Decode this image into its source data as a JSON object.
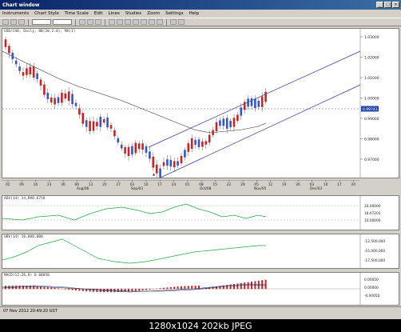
{
  "window": {
    "title": "Chart window"
  },
  "menu": [
    "Instruments",
    "Chart Style",
    "Time Scale",
    "Edit",
    "Lines",
    "Studies",
    "Zoom",
    "Settings",
    "Help"
  ],
  "chart": {
    "header": "USD/CAD, Daily, BB(20,2.0), MA(1)",
    "price_labels": [
      "1.03000",
      "1.02000",
      "1.01000",
      "1.00000",
      "0.99000",
      "0.98000",
      "0.97000"
    ],
    "current_price": "0.99741",
    "date_labels": [
      "02",
      "09",
      "16",
      "23",
      "30",
      "06",
      "13",
      "20",
      "27",
      "03",
      "10",
      "17",
      "24",
      "01",
      "08",
      "15",
      "22",
      "29",
      "05",
      "12",
      "19",
      "26",
      "03",
      "10",
      "17",
      "24"
    ],
    "month_labels": [
      "Aug/06",
      "Sep/03",
      "Oct/08",
      "Nov/05",
      "Dec/03"
    ],
    "low_label": "0.97000"
  },
  "indicator1": {
    "header": "ADX(14) 14,R#0.6718",
    "labels": [
      "20.00000",
      "18.67203",
      "10.00000"
    ],
    "current": "18.67203"
  },
  "indicator2": {
    "header": "OBV(14) 10,000,000",
    "labels": [
      "-12,500,000",
      "-15,000,000",
      "-17,500,000"
    ]
  },
  "indicator3": {
    "header": "MACD(12,26,9) 0.00050",
    "labels": [
      "0.00050",
      "0.00000",
      "-0.00050"
    ]
  },
  "status": {
    "datetime": "07 Nov 2012 20:49:20 GST"
  },
  "footer": {
    "text": "1280x1024  202kb  JPEG"
  },
  "colors": {
    "bull": "#3355cc",
    "bear": "#cc2222",
    "channel": "#3333aa",
    "ma": "#333333"
  }
}
